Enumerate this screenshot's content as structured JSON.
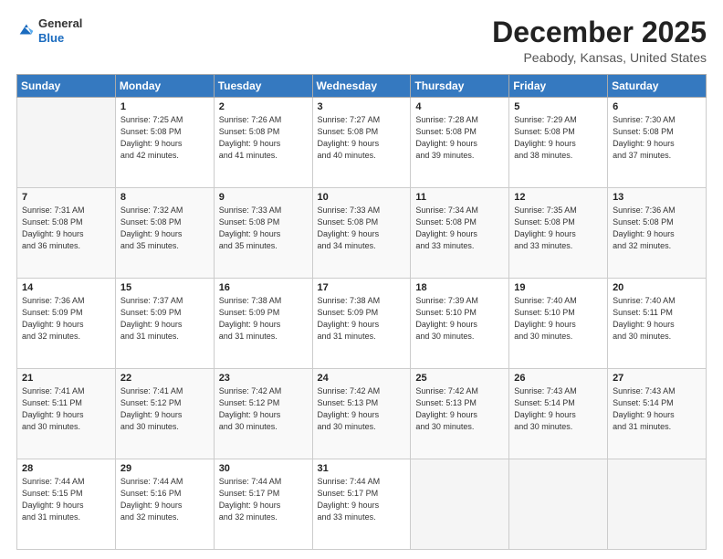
{
  "header": {
    "logo_line1": "General",
    "logo_line2": "Blue",
    "month_title": "December 2025",
    "location": "Peabody, Kansas, United States"
  },
  "weekdays": [
    "Sunday",
    "Monday",
    "Tuesday",
    "Wednesday",
    "Thursday",
    "Friday",
    "Saturday"
  ],
  "weeks": [
    [
      {
        "day": "",
        "sunrise": "",
        "sunset": "",
        "daylight": ""
      },
      {
        "day": "1",
        "sunrise": "Sunrise: 7:25 AM",
        "sunset": "Sunset: 5:08 PM",
        "daylight": "Daylight: 9 hours and 42 minutes."
      },
      {
        "day": "2",
        "sunrise": "Sunrise: 7:26 AM",
        "sunset": "Sunset: 5:08 PM",
        "daylight": "Daylight: 9 hours and 41 minutes."
      },
      {
        "day": "3",
        "sunrise": "Sunrise: 7:27 AM",
        "sunset": "Sunset: 5:08 PM",
        "daylight": "Daylight: 9 hours and 40 minutes."
      },
      {
        "day": "4",
        "sunrise": "Sunrise: 7:28 AM",
        "sunset": "Sunset: 5:08 PM",
        "daylight": "Daylight: 9 hours and 39 minutes."
      },
      {
        "day": "5",
        "sunrise": "Sunrise: 7:29 AM",
        "sunset": "Sunset: 5:08 PM",
        "daylight": "Daylight: 9 hours and 38 minutes."
      },
      {
        "day": "6",
        "sunrise": "Sunrise: 7:30 AM",
        "sunset": "Sunset: 5:08 PM",
        "daylight": "Daylight: 9 hours and 37 minutes."
      }
    ],
    [
      {
        "day": "7",
        "sunrise": "Sunrise: 7:31 AM",
        "sunset": "Sunset: 5:08 PM",
        "daylight": "Daylight: 9 hours and 36 minutes."
      },
      {
        "day": "8",
        "sunrise": "Sunrise: 7:32 AM",
        "sunset": "Sunset: 5:08 PM",
        "daylight": "Daylight: 9 hours and 35 minutes."
      },
      {
        "day": "9",
        "sunrise": "Sunrise: 7:33 AM",
        "sunset": "Sunset: 5:08 PM",
        "daylight": "Daylight: 9 hours and 35 minutes."
      },
      {
        "day": "10",
        "sunrise": "Sunrise: 7:33 AM",
        "sunset": "Sunset: 5:08 PM",
        "daylight": "Daylight: 9 hours and 34 minutes."
      },
      {
        "day": "11",
        "sunrise": "Sunrise: 7:34 AM",
        "sunset": "Sunset: 5:08 PM",
        "daylight": "Daylight: 9 hours and 33 minutes."
      },
      {
        "day": "12",
        "sunrise": "Sunrise: 7:35 AM",
        "sunset": "Sunset: 5:08 PM",
        "daylight": "Daylight: 9 hours and 33 minutes."
      },
      {
        "day": "13",
        "sunrise": "Sunrise: 7:36 AM",
        "sunset": "Sunset: 5:08 PM",
        "daylight": "Daylight: 9 hours and 32 minutes."
      }
    ],
    [
      {
        "day": "14",
        "sunrise": "Sunrise: 7:36 AM",
        "sunset": "Sunset: 5:09 PM",
        "daylight": "Daylight: 9 hours and 32 minutes."
      },
      {
        "day": "15",
        "sunrise": "Sunrise: 7:37 AM",
        "sunset": "Sunset: 5:09 PM",
        "daylight": "Daylight: 9 hours and 31 minutes."
      },
      {
        "day": "16",
        "sunrise": "Sunrise: 7:38 AM",
        "sunset": "Sunset: 5:09 PM",
        "daylight": "Daylight: 9 hours and 31 minutes."
      },
      {
        "day": "17",
        "sunrise": "Sunrise: 7:38 AM",
        "sunset": "Sunset: 5:09 PM",
        "daylight": "Daylight: 9 hours and 31 minutes."
      },
      {
        "day": "18",
        "sunrise": "Sunrise: 7:39 AM",
        "sunset": "Sunset: 5:10 PM",
        "daylight": "Daylight: 9 hours and 30 minutes."
      },
      {
        "day": "19",
        "sunrise": "Sunrise: 7:40 AM",
        "sunset": "Sunset: 5:10 PM",
        "daylight": "Daylight: 9 hours and 30 minutes."
      },
      {
        "day": "20",
        "sunrise": "Sunrise: 7:40 AM",
        "sunset": "Sunset: 5:11 PM",
        "daylight": "Daylight: 9 hours and 30 minutes."
      }
    ],
    [
      {
        "day": "21",
        "sunrise": "Sunrise: 7:41 AM",
        "sunset": "Sunset: 5:11 PM",
        "daylight": "Daylight: 9 hours and 30 minutes."
      },
      {
        "day": "22",
        "sunrise": "Sunrise: 7:41 AM",
        "sunset": "Sunset: 5:12 PM",
        "daylight": "Daylight: 9 hours and 30 minutes."
      },
      {
        "day": "23",
        "sunrise": "Sunrise: 7:42 AM",
        "sunset": "Sunset: 5:12 PM",
        "daylight": "Daylight: 9 hours and 30 minutes."
      },
      {
        "day": "24",
        "sunrise": "Sunrise: 7:42 AM",
        "sunset": "Sunset: 5:13 PM",
        "daylight": "Daylight: 9 hours and 30 minutes."
      },
      {
        "day": "25",
        "sunrise": "Sunrise: 7:42 AM",
        "sunset": "Sunset: 5:13 PM",
        "daylight": "Daylight: 9 hours and 30 minutes."
      },
      {
        "day": "26",
        "sunrise": "Sunrise: 7:43 AM",
        "sunset": "Sunset: 5:14 PM",
        "daylight": "Daylight: 9 hours and 30 minutes."
      },
      {
        "day": "27",
        "sunrise": "Sunrise: 7:43 AM",
        "sunset": "Sunset: 5:14 PM",
        "daylight": "Daylight: 9 hours and 31 minutes."
      }
    ],
    [
      {
        "day": "28",
        "sunrise": "Sunrise: 7:44 AM",
        "sunset": "Sunset: 5:15 PM",
        "daylight": "Daylight: 9 hours and 31 minutes."
      },
      {
        "day": "29",
        "sunrise": "Sunrise: 7:44 AM",
        "sunset": "Sunset: 5:16 PM",
        "daylight": "Daylight: 9 hours and 32 minutes."
      },
      {
        "day": "30",
        "sunrise": "Sunrise: 7:44 AM",
        "sunset": "Sunset: 5:17 PM",
        "daylight": "Daylight: 9 hours and 32 minutes."
      },
      {
        "day": "31",
        "sunrise": "Sunrise: 7:44 AM",
        "sunset": "Sunset: 5:17 PM",
        "daylight": "Daylight: 9 hours and 33 minutes."
      },
      {
        "day": "",
        "sunrise": "",
        "sunset": "",
        "daylight": ""
      },
      {
        "day": "",
        "sunrise": "",
        "sunset": "",
        "daylight": ""
      },
      {
        "day": "",
        "sunrise": "",
        "sunset": "",
        "daylight": ""
      }
    ]
  ]
}
